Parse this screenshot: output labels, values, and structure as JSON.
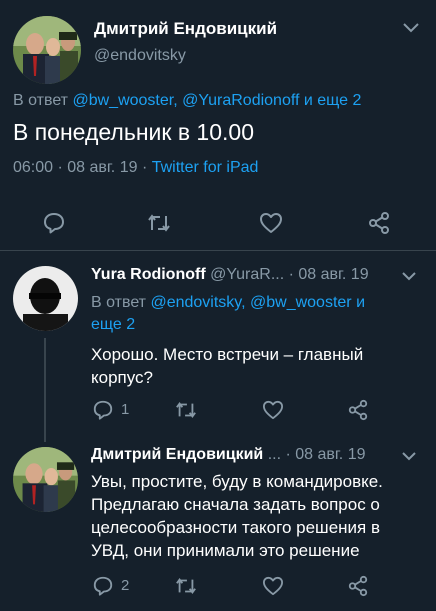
{
  "main_tweet": {
    "author_name": "Дмитрий Ендовицкий",
    "author_handle": "@endovitsky",
    "reply_prefix": "В ответ",
    "reply_to": "@bw_wooster, @YuraRodionoff и еще 2",
    "text": "В понедельник в 10.00",
    "time": "06:00",
    "sep1": "·",
    "date": "08 авг. 19",
    "sep2": "·",
    "source": "Twitter for iPad"
  },
  "reply1": {
    "author_name": "Yura Rodionoff",
    "author_handle": "@YuraR...",
    "sep": "·",
    "date": "08 авг. 19",
    "reply_prefix": "В ответ",
    "reply_to_line1": "@endovitsky, @bw_wooster и",
    "reply_to_line2": "еще 2",
    "text_line1": "Хорошо. Место встречи – главный",
    "text_line2": "корпус?",
    "reply_count": "1"
  },
  "reply2": {
    "author_name": "Дмитрий Ендовицкий",
    "ellipsis": "...",
    "sep": "·",
    "date": "08 авг. 19",
    "text_line1": "Увы, простите, буду в командировке.",
    "text_line2": "Предлагаю сначала задать вопрос о",
    "text_line3": "целесообразности такого решения в",
    "text_line4": "УВД, они принимали это решение",
    "reply_count": "2"
  },
  "colors": {
    "background": "#15202b",
    "accent": "#1da1f2",
    "muted": "#8899a6",
    "divider": "#38444d"
  }
}
